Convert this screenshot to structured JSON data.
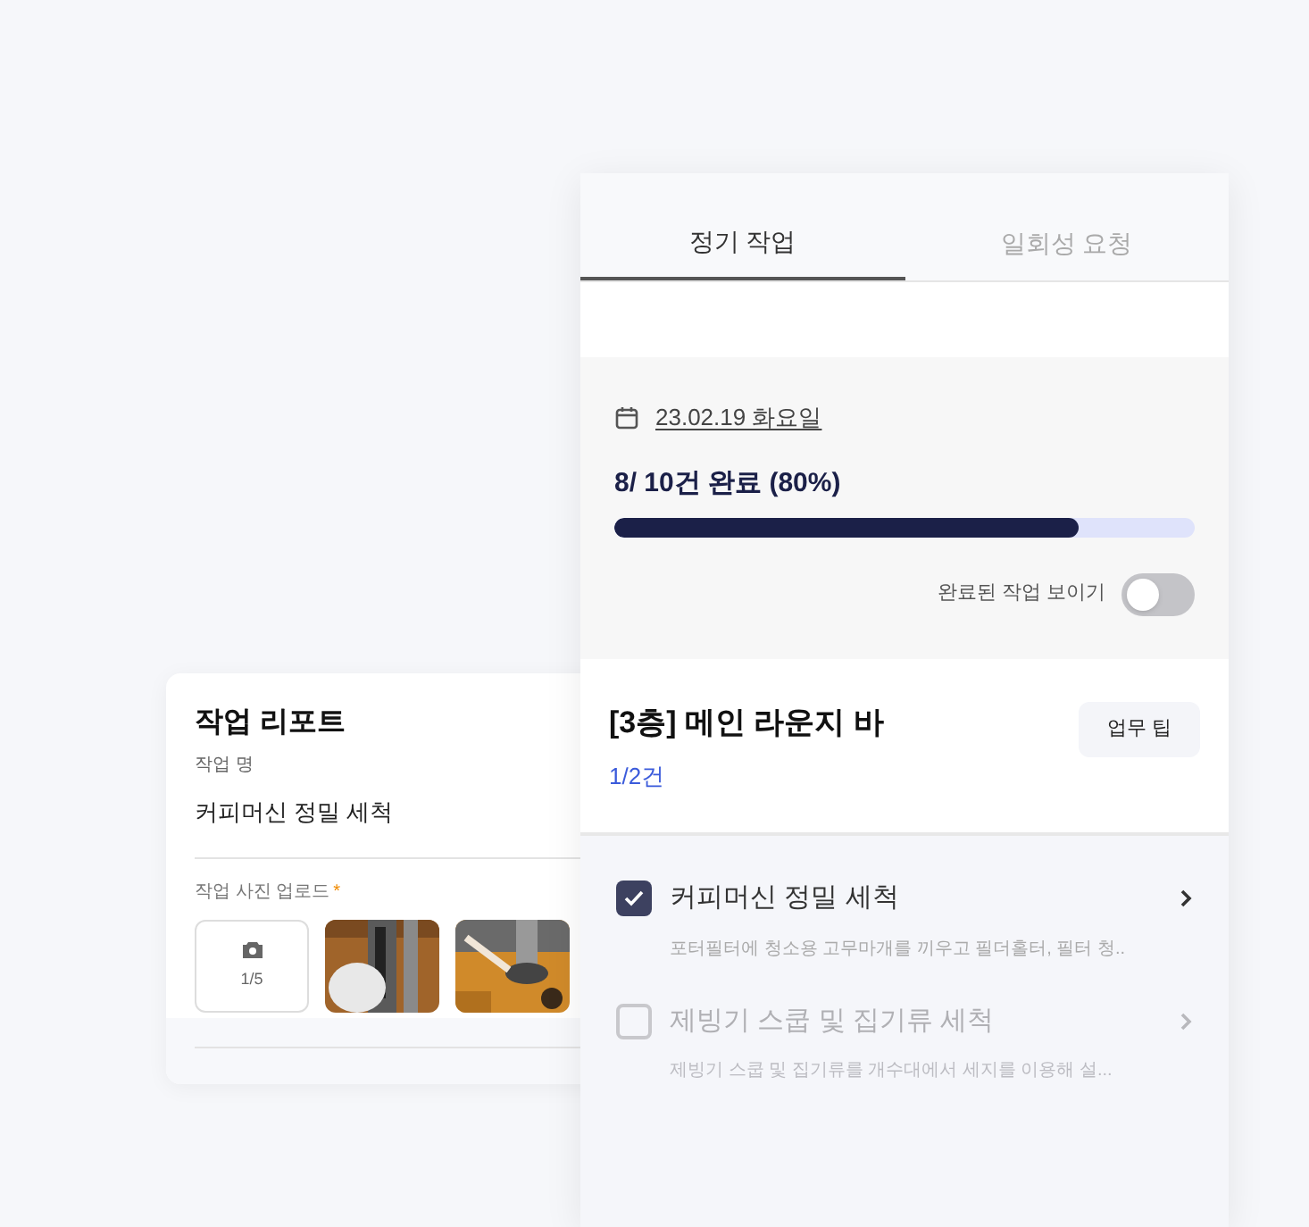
{
  "report_card": {
    "title": "작업 리포트",
    "name_label": "작업 명",
    "name_value": "커피머신 정밀 세척",
    "photo_label": "작업 사진 업로드",
    "required_mark": "*",
    "upload_count": "1/5"
  },
  "tabs": [
    {
      "label": "정기 작업",
      "selected": true
    },
    {
      "label": "일회성 요청",
      "selected": false
    }
  ],
  "summary": {
    "date": "23.02.19 화요일",
    "progress_text": "8/ 10건 완료 (80%)",
    "level": 0.8,
    "toggle_label": "완료된 작업 보이기",
    "toggle_on": false
  },
  "location": {
    "title": "[3층] 메인 라운지 바",
    "count": "1/2건",
    "tip_button": "업무 팁"
  },
  "tasks": [
    {
      "title": "커피머신 정밀 세척",
      "description": "포터필터에 청소용 고무마개를 끼우고 필더홀터, 필터 청..",
      "checked": true
    },
    {
      "title": "제빙기 스쿱 및 집기류 세척",
      "description": "제빙기 스쿱 및 집기류를 개수대에서 세지를 이용해 설...",
      "checked": false
    }
  ]
}
